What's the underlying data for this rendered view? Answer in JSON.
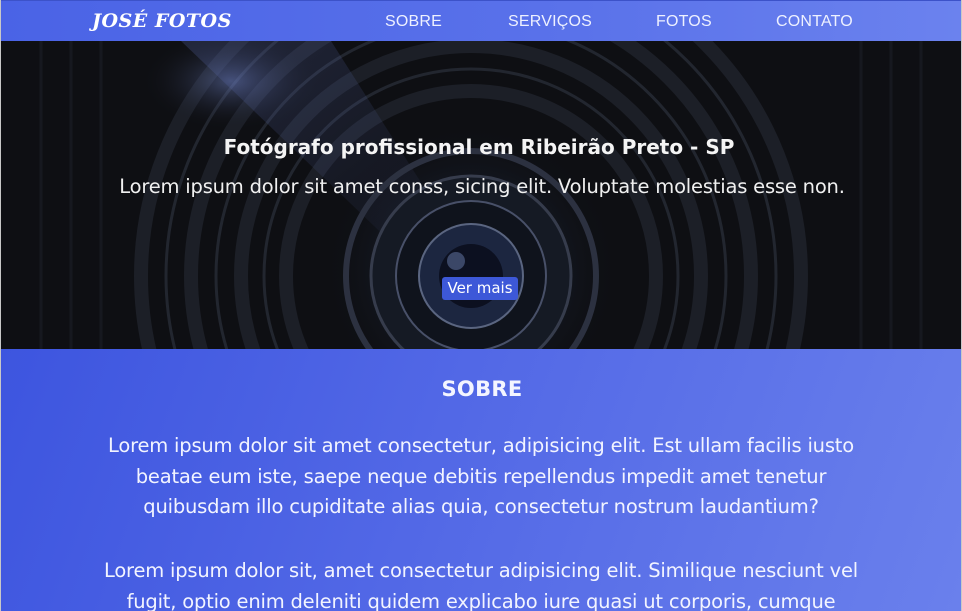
{
  "navbar": {
    "logo": "JOSÉ FOTOS",
    "links": [
      "SOBRE",
      "SERVIÇOS",
      "FOTOS",
      "CONTATO"
    ]
  },
  "hero": {
    "title": "Fotógrafo profissional em Ribeirão Preto - SP",
    "subtitle": "Lorem ipsum dolor sit amet conss, sicing elit. Voluptate molestias esse non.",
    "button_label": "Ver mais"
  },
  "sobre": {
    "title": "SOBRE",
    "paragraphs": [
      "Lorem ipsum dolor sit amet consectetur, adipisicing elit. Est ullam facilis iusto beatae eum iste, saepe neque debitis repellendus impedit amet tenetur quibusdam illo cupiditate alias quia, consectetur nostrum laudantium?",
      "Lorem ipsum dolor sit, amet consectetur adipisicing elit. Similique nesciunt vel fugit, optio enim deleniti quidem explicabo iure quasi ut corporis, cumque"
    ]
  },
  "colors": {
    "accent": "#4a63e6",
    "button": "#3d58d8",
    "hero_bg": "#0d0e12"
  }
}
